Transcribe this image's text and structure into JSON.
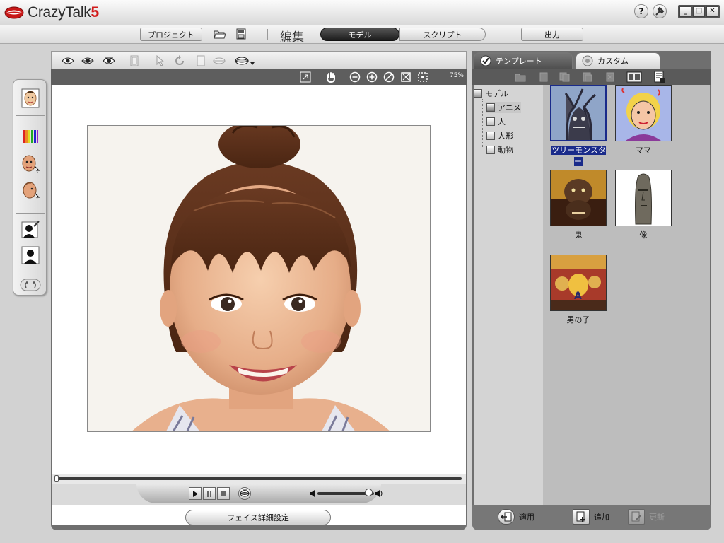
{
  "app": {
    "name": "CrazyTalk",
    "version": "5"
  },
  "titlebar": {
    "help_label": "?"
  },
  "nav": {
    "project": "プロジェクト",
    "edit_heading": "編集",
    "model": "モデル",
    "script": "スクリプト",
    "output": "出力",
    "active_tab": "モデル"
  },
  "editor": {
    "zoom": "75%",
    "face_settings_button": "フェイス詳細設定",
    "timeline_position": 0,
    "volume": 0.9
  },
  "library": {
    "tabs": [
      {
        "label": "テンプレート",
        "active": true
      },
      {
        "label": "カスタム",
        "active": false
      }
    ],
    "tree": {
      "root": "モデル",
      "children": [
        "アニメ",
        "人",
        "人形",
        "動物"
      ],
      "selected": "アニメ"
    },
    "thumbnails": [
      {
        "label": "ツリーモンスター",
        "selected": true
      },
      {
        "label": "ママ",
        "selected": false
      },
      {
        "label": "鬼",
        "selected": false
      },
      {
        "label": "像",
        "selected": false
      },
      {
        "label": "男の子",
        "selected": false
      }
    ],
    "actions": {
      "apply": "適用",
      "add": "追加",
      "update": "更新"
    }
  },
  "colors": {
    "accent_red": "#d21c1c",
    "selection_blue": "#1a2b8a",
    "panel_gray": "#6f6f6f"
  }
}
